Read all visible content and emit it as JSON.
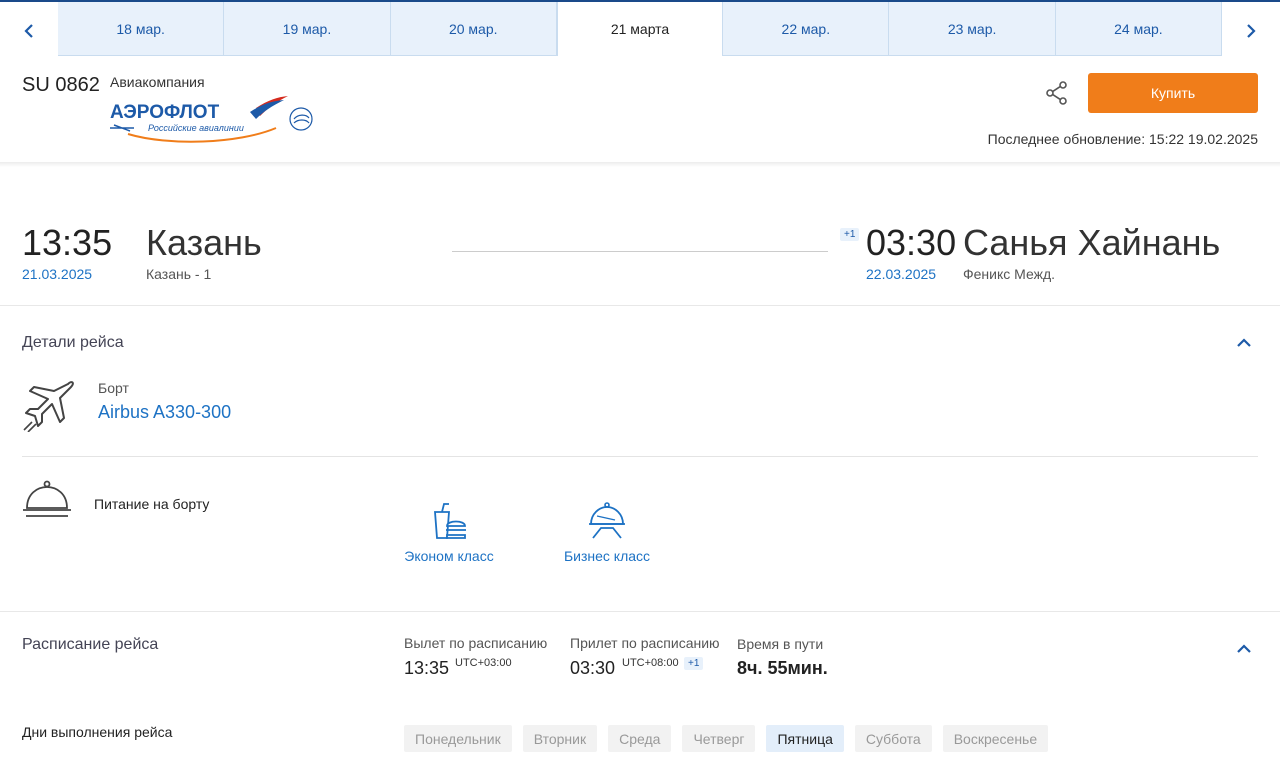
{
  "dates": {
    "tabs": [
      "18 мар.",
      "19 мар.",
      "20 мар.",
      "21 марта",
      "22 мар.",
      "23 мар.",
      "24 мар."
    ],
    "active_index": 3
  },
  "header": {
    "flight_number": "SU 0862",
    "airline_label": "Авиакомпания",
    "logo_text": "АЭРОФЛОТ",
    "logo_subtext": "Российские авиалинии",
    "buy_label": "Купить",
    "updated": "Последнее обновление: 15:22 19.02.2025"
  },
  "route": {
    "departure": {
      "time": "13:35",
      "date": "21.03.2025",
      "city": "Казань",
      "airport": "Казань - 1"
    },
    "arrival": {
      "time": "03:30",
      "date": "22.03.2025",
      "city": "Санья Хайнань",
      "airport": "Феникс Межд.",
      "day_offset": "+1"
    }
  },
  "details": {
    "title": "Детали рейса",
    "aircraft_label": "Борт",
    "aircraft": "Airbus A330-300",
    "meals_label": "Питание на борту",
    "meal_classes": [
      "Эконом класс",
      "Бизнес класс"
    ]
  },
  "schedule": {
    "title": "Расписание рейса",
    "departure_label": "Вылет по расписанию",
    "departure_time": "13:35",
    "departure_utc": "UTC+03:00",
    "arrival_label": "Прилет по расписанию",
    "arrival_time": "03:30",
    "arrival_utc": "UTC+08:00",
    "arrival_offset": "+1",
    "duration_label": "Время в пути",
    "duration": "8ч. 55мин.",
    "days_label": "Дни выполнения рейса",
    "days": [
      "Понедельник",
      "Вторник",
      "Среда",
      "Четверг",
      "Пятница",
      "Суббота",
      "Воскресенье"
    ],
    "active_day": "Пятница"
  },
  "colors": {
    "accent": "#1d72c4",
    "buy": "#f07d1a",
    "tab_bg": "#e8f1fb"
  }
}
